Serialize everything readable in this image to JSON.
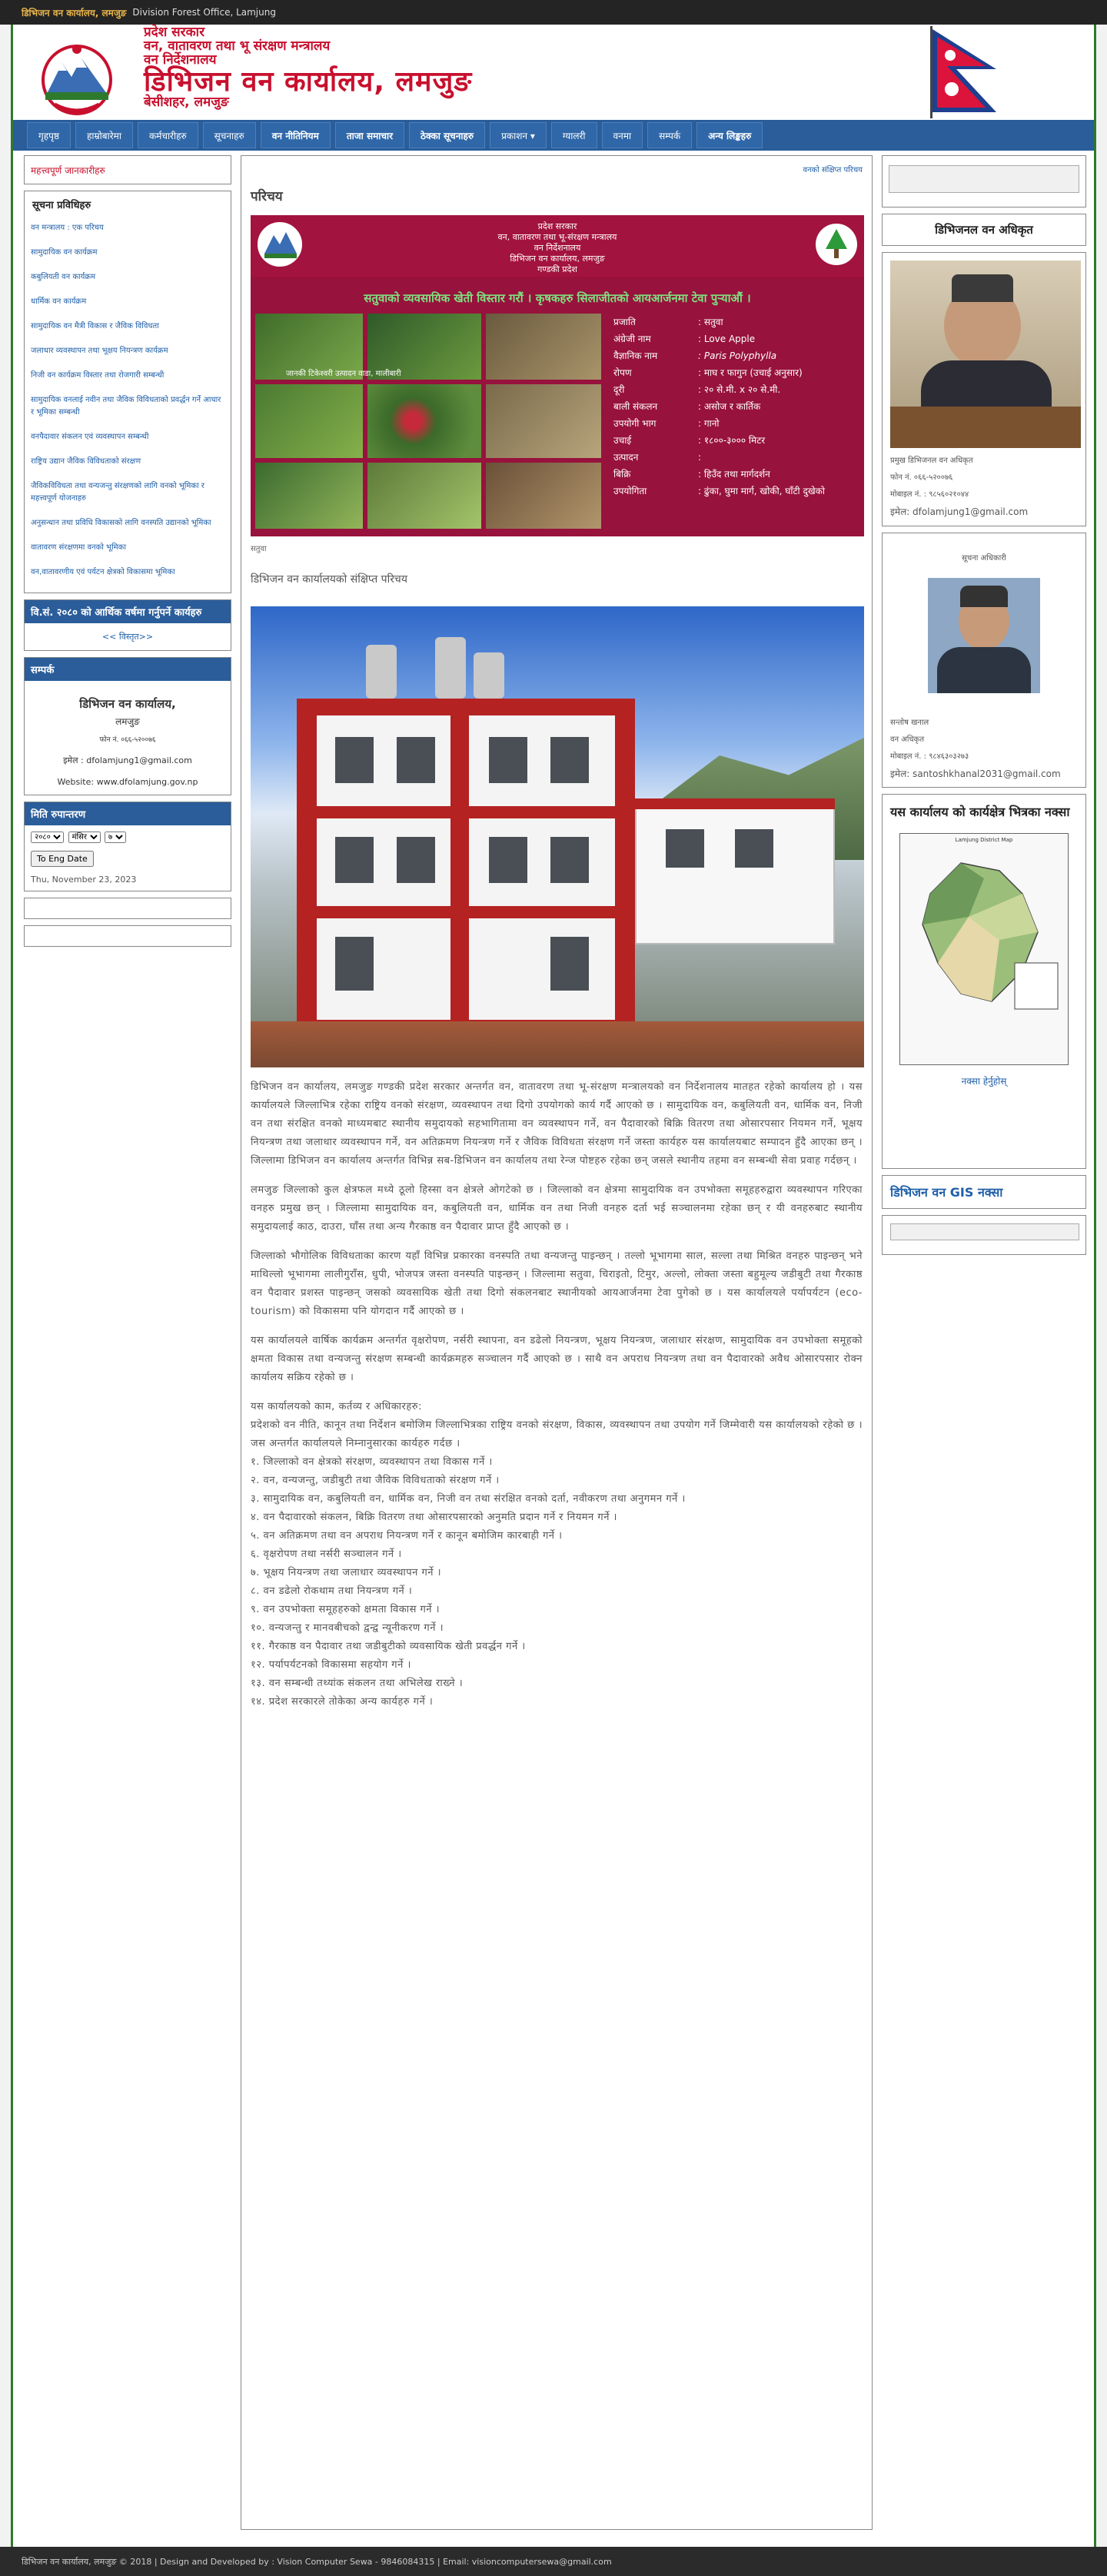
{
  "topbar": {
    "office_ne": "डिभिजन वन कार्यालय, लमजुङ",
    "office_en": "Division Forest Office, Lamjung"
  },
  "header": {
    "line1": "प्रदेश सरकार",
    "line2": "वन, वातावरण तथा भू संरक्षण मन्त्रालय",
    "line3": "वन निर्देशनालय",
    "title": "डिभिजन वन कार्यालय, लमजुङ",
    "place": "बेसीशहर, लमजुङ"
  },
  "nav": [
    "गृहपृष्ठ",
    "हाम्रोबारेमा",
    "कर्मचारीहरु",
    "सूचनाहरु",
    "वन नीतिनियम",
    "ताजा समाचार",
    "ठेक्का सूचनाहरु",
    "प्रकाशन",
    "ग्यालरी",
    "वनमा",
    "सम्पर्क",
    "अन्य  लिङ्कहरु"
  ],
  "left": {
    "notice_title": "महत्त्वपूर्ण जानकारीहरु",
    "info_title": "सूचना प्रविधिहरु",
    "info_items": [
      "वन मन्त्रालय : एक परिचय",
      "सामुदायिक वन कार्यक्रम",
      "कबुलियती वन कार्यक्रम",
      "धार्मिक वन कार्यक्रम",
      "सामुदायिक वन मैत्री विकास र जैविक विविधता",
      "जलाधार व्यवस्थापन तथा भूक्षय नियन्त्रण कार्यक्रम",
      "निजी वन कार्यक्रम विस्तार तथा रोजगारी सम्बन्धी",
      "सामुदायिक वनलाई नवीन तथा जैविक विविधताको प्रवर्द्धन गर्ने आधार र भूमिका सम्बन्धी",
      "वनपैदावार संकलन एवं व्यवस्थापन सम्बन्धी",
      "राष्ट्रिय उद्यान जैविक विविधताको संरक्षण",
      "जैविकविविधता तथा वन्यजन्तु संरक्षणको लागि वनको भूमिका र महत्त्वपूर्ण योजनाहरु",
      "अनुसन्धान तथा प्रविधि विकासको लागि वनस्पति उद्यानको भूमिका",
      "वातावरण संरक्षणमा वनको भूमिका",
      "वन,वातावरणीय एवं पर्यटन क्षेत्रको विकासमा भूमिका"
    ],
    "circular_title": "वि.सं. २०८० को आर्थिक वर्षमा गर्नुपर्ने कार्यहरु",
    "circular_link": "<< विस्तृत>>",
    "address_title": "सम्पर्क",
    "address_name": "डिभिजन वन कार्यालय,",
    "address_place": "लमजुङ",
    "address_phone": "फोन नं. ०६६-५२००७६",
    "address_email": "इमेल : dfolamjung1@gmail.com",
    "address_web": "Website: www.dfolamjung.gov.np",
    "date_title": "मिति रुपान्तरण",
    "date_selects": [
      "२०८०",
      "मंसिर",
      "७"
    ],
    "date_button": "To Eng Date",
    "date_value": "Thu, November 23, 2023"
  },
  "main": {
    "breadcrumb": "वनको संक्षिप्त परिचय",
    "page_title": "परिचय",
    "banner": {
      "top_lines": [
        "प्रदेश सरकार",
        "वन, वातावरण तथा भू-संरक्षण मन्त्रालय",
        "वन निर्देशनालय",
        "डिभिजन वन कार्यालय, लमजुङ",
        "गण्डकी प्रदेश"
      ],
      "slogan": "सतुवाको व्यवसायिक खेती विस्तार गरौं । कृषकहरु सिलाजीतको आयआर्जनमा टेवा पुऱ्याऔं ।",
      "labels": [
        "प्रजाति",
        "अंग्रेजी नाम",
        "वैज्ञानिक नाम",
        "रोपण",
        "दूरी",
        "बाली संकलन",
        "उपयोगी भाग",
        "उचाई",
        "उत्पादन",
        "बिक्रि",
        "उपयोगिता"
      ],
      "values": [
        ": सतुवा",
        ": Love Apple",
        ": Paris Polyphylla",
        ": माघ र फागुन (उचाई अनुसार)",
        ": २० से.मी. x २० से.मी.",
        ": असोज र कार्तिक",
        ": गानो",
        ": १८००-३००० मिटर",
        ":",
        ": हिउँद तथा मार्गदर्शन",
        ": ढुंका, घुमा मार्ग, खोकी, घाँटी दुखेको"
      ],
      "photo_caption": "जानकी टिकेश्वरी उत्पादन वाडा, मालीबारी"
    },
    "caption": "सतुवा",
    "subheading": "डिभिजन वन कार्यालयको संक्षिप्त परिचय",
    "paragraphs": [
      "डिभिजन वन कार्यालय, लमजुङ गण्डकी प्रदेश सरकार अन्तर्गत वन, वातावरण तथा भू-संरक्षण मन्त्रालयको वन निर्देशनालय मातहत रहेको कार्यालय हो । यस कार्यालयले जिल्लाभित्र रहेका राष्ट्रिय वनको संरक्षण, व्यवस्थापन तथा दिगो उपयोगको कार्य गर्दै आएको छ । सामुदायिक वन, कबुलियती वन, धार्मिक वन, निजी वन तथा संरक्षित वनको माध्यमबाट स्थानीय समुदायको सहभागितामा वन व्यवस्थापन गर्ने, वन पैदावारको बिक्रि वितरण तथा ओसारपसार नियमन गर्ने, भूक्षय नियन्त्रण तथा जलाधार व्यवस्थापन गर्ने, वन अतिक्रमण नियन्त्रण गर्ने र जैविक विविधता संरक्षण गर्ने जस्ता कार्यहरु यस कार्यालयबाट सम्पादन हुँदै आएका छन् । जिल्लामा डिभिजन वन कार्यालय अन्तर्गत विभिन्न सब-डिभिजन वन कार्यालय तथा रेन्ज पोष्टहरु रहेका छन् जसले स्थानीय तहमा वन सम्बन्धी सेवा प्रवाह गर्दछन् ।",
      "लमजुङ जिल्लाको कुल क्षेत्रफल मध्ये ठूलो हिस्सा वन क्षेत्रले ओगटेको छ । जिल्लाको वन क्षेत्रमा सामुदायिक वन उपभोक्ता समूहहरुद्वारा व्यवस्थापन गरिएका वनहरु प्रमुख छन् । जिल्लामा सामुदायिक वन, कबुलियती वन, धार्मिक वन तथा निजी वनहरु दर्ता भई सञ्चालनमा रहेका छन् र यी वनहरुबाट स्थानीय समुदायलाई काठ, दाउरा, घाँस तथा अन्य गैरकाष्ठ वन पैदावार प्राप्त हुँदै आएको छ ।",
      "जिल्लाको भौगोलिक विविधताका कारण यहाँ विभिन्न प्रकारका वनस्पति तथा वन्यजन्तु पाइन्छन् । तल्लो भूभागमा साल, सल्ला तथा मिश्रित वनहरु पाइन्छन् भने माथिल्लो भूभागमा लालीगुराँस, धुपी, भोजपत्र जस्ता वनस्पति पाइन्छन् । जिल्लामा सतुवा, चिराइतो, टिमुर, अल्लो, लोक्ता जस्ता बहुमूल्य जडीबुटी तथा गैरकाष्ठ वन पैदावार प्रशस्त पाइन्छन् जसको व्यवसायिक खेती तथा दिगो संकलनबाट स्थानीयको आयआर्जनमा टेवा पुगेको छ । यस कार्यालयले पर्यापर्यटन (eco-tourism) को विकासमा पनि योगदान गर्दै आएको छ ।",
      "यस कार्यालयले वार्षिक कार्यक्रम अन्तर्गत वृक्षरोपण, नर्सरी स्थापना, वन डढेलो नियन्त्रण, भूक्षय नियन्त्रण, जलाधार संरक्षण, सामुदायिक वन उपभोक्ता समूहको क्षमता विकास तथा वन्यजन्तु संरक्षण सम्बन्धी कार्यक्रमहरु सञ्चालन गर्दै आएको छ । साथै वन अपराध नियन्त्रण तथा वन पैदावारको अवैध ओसारपसार रोक्न कार्यालय सक्रिय रहेको छ ।"
    ],
    "duties_title": "यस कार्यालयको काम, कर्तव्य र अधिकारहरु:",
    "duties_intro": "प्रदेशको वन नीति, कानून तथा निर्देशन बमोजिम जिल्लाभित्रका राष्ट्रिय वनको संरक्षण, विकास, व्यवस्थापन तथा उपयोग गर्ने जिम्मेवारी यस कार्यालयको रहेको छ । जस अन्तर्गत कार्यालयले निम्नानुसारका कार्यहरु गर्दछ ।",
    "duties": [
      "१.  जिल्लाको वन क्षेत्रको संरक्षण, व्यवस्थापन तथा विकास गर्ने ।",
      "२. वन, वन्यजन्तु, जडीबुटी तथा जैविक विविधताको संरक्षण गर्ने ।",
      "३.  सामुदायिक वन, कबुलियती वन, धार्मिक वन, निजी वन तथा संरक्षित वनको दर्ता, नवीकरण तथा अनुगमन गर्ने ।",
      "४.  वन पैदावारको संकलन, बिक्रि वितरण तथा ओसारपसारको अनुमति प्रदान गर्ने र नियमन गर्ने ।",
      "५.  वन अतिक्रमण तथा वन अपराध नियन्त्रण गर्ने र कानून बमोजिम कारबाही गर्ने ।",
      "६.  वृक्षरोपण तथा नर्सरी सञ्चालन गर्ने ।",
      "७.  भूक्षय नियन्त्रण तथा जलाधार व्यवस्थापन गर्ने ।",
      "८.  वन डढेलो रोकथाम तथा नियन्त्रण गर्ने ।",
      "९.  वन उपभोक्ता समूहहरुको क्षमता विकास गर्ने ।",
      "१०.  वन्यजन्तु र मानवबीचको द्वन्द्व न्यूनीकरण गर्ने ।",
      "११.  गैरकाष्ठ वन पैदावार तथा जडीबुटीको व्यवसायिक खेती प्रवर्द्धन गर्ने ।",
      "१२.  पर्यापर्यटनको विकासमा सहयोग गर्ने ।",
      "१३.  वन सम्बन्धी तथ्यांक संकलन तथा अभिलेख राख्ने ।",
      "१४.  प्रदेश सरकारले तोकेका अन्य कार्यहरु गर्ने ।"
    ]
  },
  "right": {
    "officer_title": "डिभिजनल वन अधिकृत",
    "officer_lines": [
      "प्रमुख डिभिजनल वन अधिकृत",
      "फोन नं. ०६६-५२००७६",
      "मोबाइल नं. : ९८५६०२१०४४"
    ],
    "officer_email": "इमेल: dfolamjung1@gmail.com",
    "info_officer_title": "सूचना अधिकारी",
    "info_officer_lines": [
      "सन्तोष खनाल",
      "वन अधिकृत",
      "मोबाइल नं. : ९८४६३०३२७३"
    ],
    "info_officer_email": "इमेल: santoshkhanal2031@gmail.com",
    "map_heading": "यस कार्यालय को कार्यक्षेत्र भित्रका नक्सा",
    "map_title": "Lamjung District Map",
    "map_link": "नक्सा हेर्नुहोस्",
    "gis_title": "डिभिजन वन GIS नक्सा"
  },
  "footer": {
    "text": "डिभिजन वन कार्यालय, लमजुङ © 2018 | Design and Developed by : Vision Computer Sewa - 9846084315 | Email: visioncomputersewa@gmail.com"
  },
  "colors": {
    "nav": "#2a5d9a",
    "red": "#c8102e",
    "green_border": "#2d7a2d",
    "banner": "#97123d"
  }
}
